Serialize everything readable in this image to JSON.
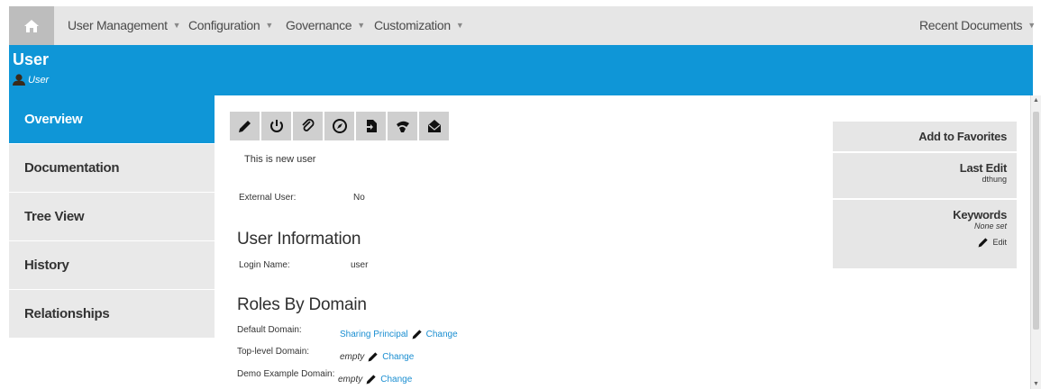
{
  "nav": {
    "home_icon": "home-icon",
    "items": [
      {
        "label": "User Management"
      },
      {
        "label": "Configuration"
      },
      {
        "label": "Governance"
      },
      {
        "label": "Customization"
      }
    ],
    "recent_documents": "Recent Documents"
  },
  "header": {
    "title": "User",
    "subtitle": "User",
    "color": "#0f96d7"
  },
  "sidebar": {
    "items": [
      {
        "label": "Overview",
        "active": true
      },
      {
        "label": "Documentation"
      },
      {
        "label": "Tree View"
      },
      {
        "label": "History"
      },
      {
        "label": "Relationships"
      }
    ]
  },
  "toolbar": {
    "icons": [
      "pencil-icon",
      "power-icon",
      "paperclip-icon",
      "compass-icon",
      "export-icon",
      "subscribe-icon",
      "envelope-icon"
    ]
  },
  "main": {
    "description": "This is new user",
    "external_user_label": "External User:",
    "external_user_value": "No",
    "user_info_heading": "User Information",
    "login_name_label": "Login Name:",
    "login_name_value": "user",
    "roles_heading": "Roles By Domain",
    "roles": [
      {
        "domain": "Default Domain:",
        "value": "Sharing Principal",
        "value_is_link": true,
        "action": "Change"
      },
      {
        "domain": "Top-level Domain:",
        "value": "empty",
        "value_is_link": false,
        "action": "Change"
      },
      {
        "domain": "Demo Example Domain:",
        "value": "empty",
        "value_is_link": false,
        "action": "Change"
      }
    ]
  },
  "right_panel": {
    "add_favorites": "Add to Favorites",
    "last_edit_title": "Last Edit",
    "last_edit_value": "dthung",
    "keywords_title": "Keywords",
    "keywords_value": "None set",
    "keywords_edit": "Edit"
  }
}
